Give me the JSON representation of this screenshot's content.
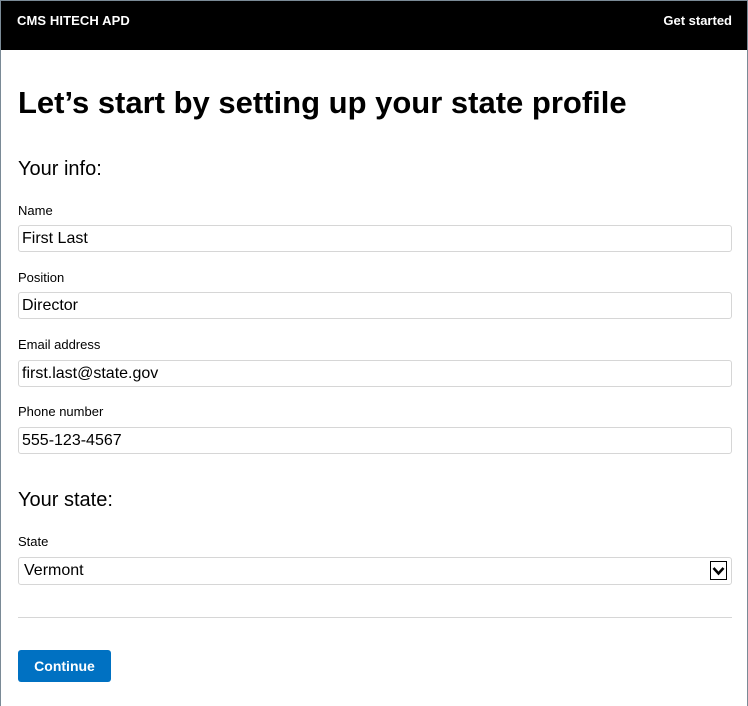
{
  "header": {
    "brand": "CMS HITECH APD",
    "nav_link": "Get started"
  },
  "page": {
    "title": "Let’s start by setting up your state profile"
  },
  "your_info": {
    "heading": "Your info:",
    "name_label": "Name",
    "name_value": "First Last",
    "position_label": "Position",
    "position_value": "Director",
    "email_label": "Email address",
    "email_value": "first.last@state.gov",
    "phone_label": "Phone number",
    "phone_value": "555-123-4567"
  },
  "your_state": {
    "heading": "Your state:",
    "state_label": "State",
    "state_value": "Vermont",
    "arrow_icon": "chevron-down-icon"
  },
  "actions": {
    "continue_label": "Continue"
  },
  "colors": {
    "header_bg": "#000000",
    "primary_button": "#0071c2",
    "input_border": "#d6d6d6"
  }
}
